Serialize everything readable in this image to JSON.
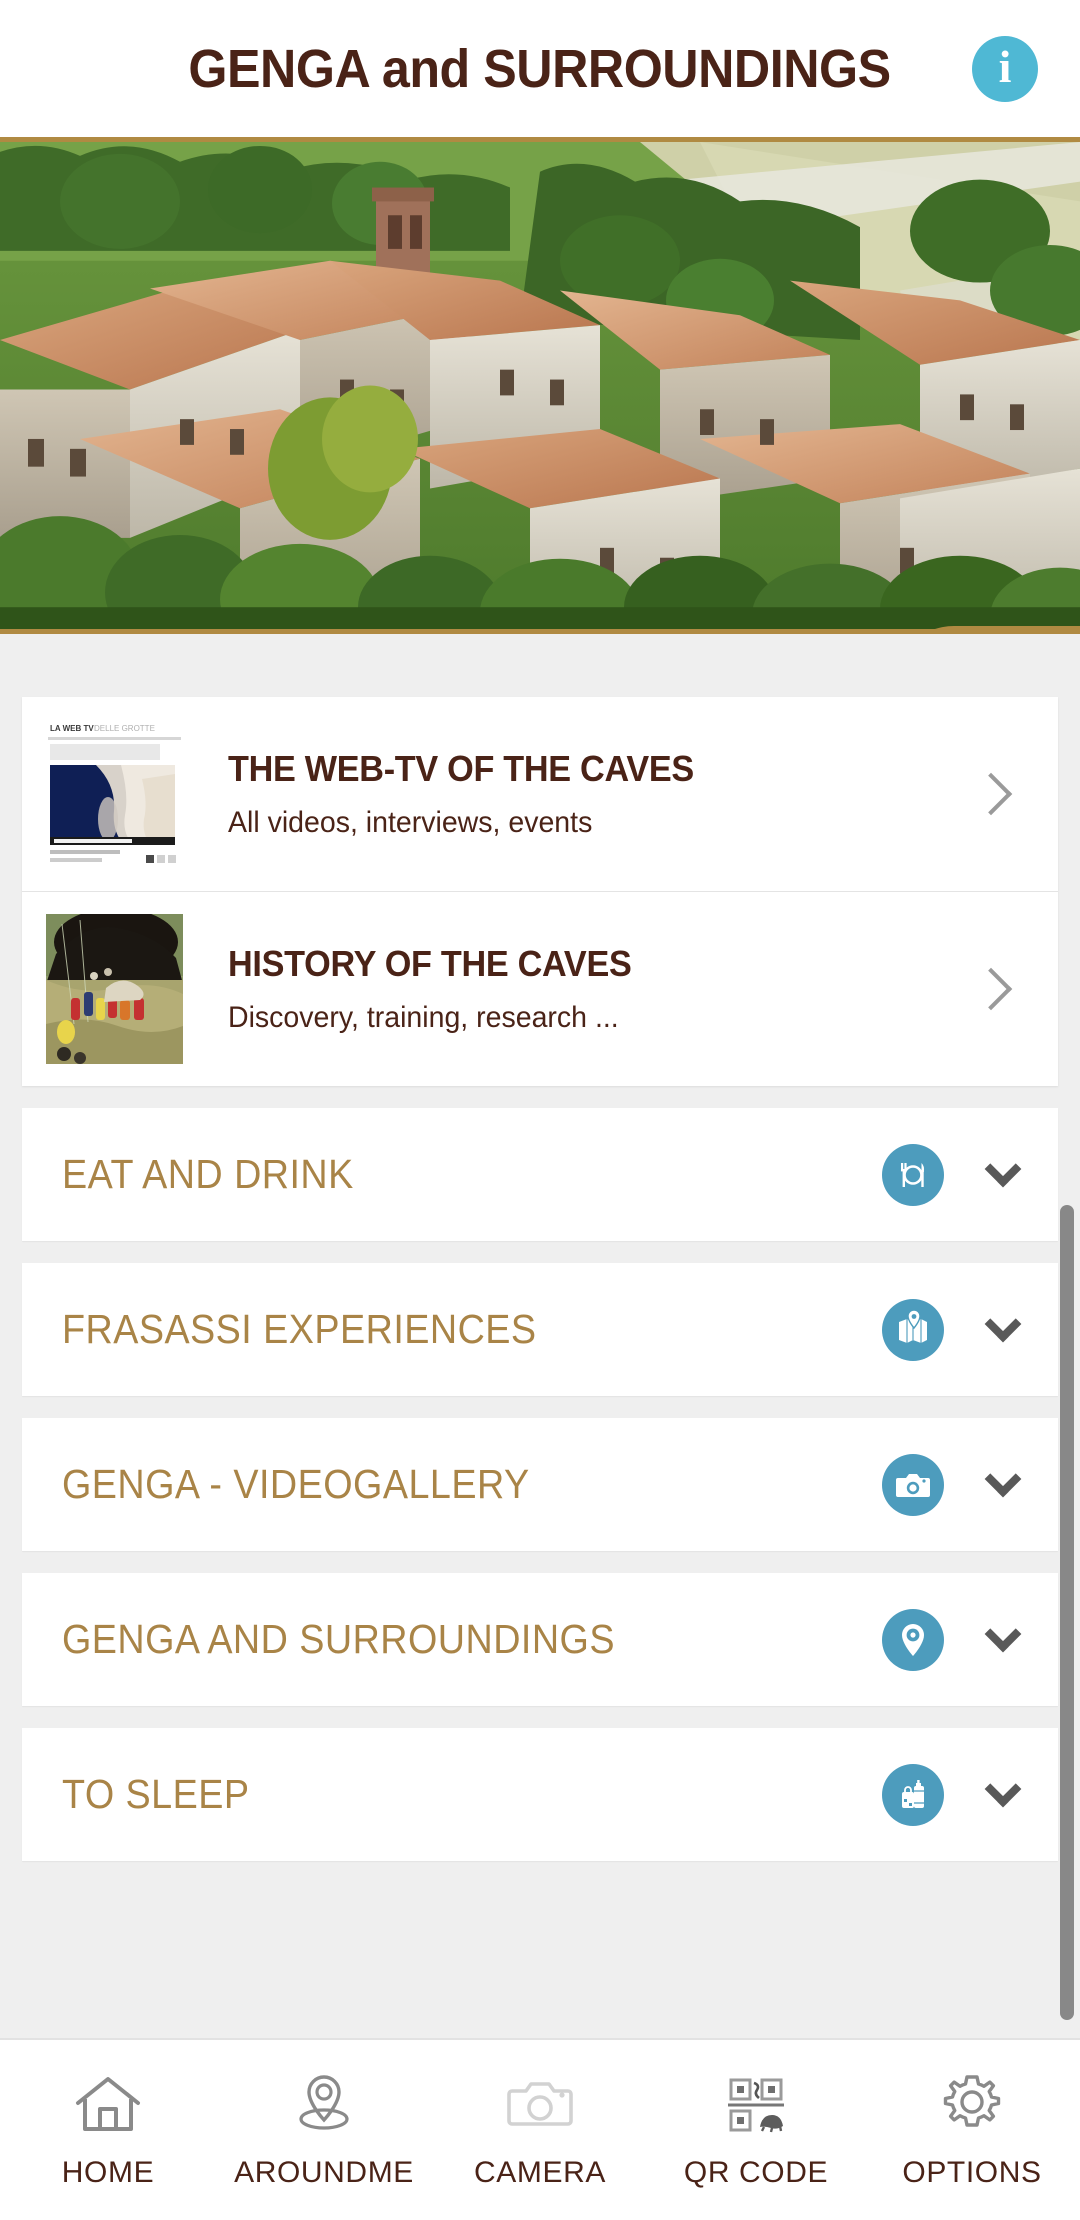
{
  "header": {
    "title": "GENGA and SURROUNDINGS",
    "info_icon": "info-icon",
    "info_glyph": "i",
    "accent_gold": "#b08a42",
    "title_color": "#4a2317",
    "info_bg": "#4fb8d4"
  },
  "hero": {
    "name": "genga-aerial-view",
    "alt": "Aerial view of Genga hill town with terracotta roofs",
    "collapse_icon": "chevron-up-icon",
    "collapse_bg": "#b08a42"
  },
  "features": [
    {
      "title": "THE WEB-TV OF THE CAVES",
      "subtitle": "All videos, interviews, events",
      "thumb": "webtv-screenshot-thumbnail",
      "thumb_caption": "LA WEB TV DELLE GROTTE",
      "chevron": "chevron-right-icon"
    },
    {
      "title": "HISTORY OF THE CAVES",
      "subtitle": "Discovery, training, research ...",
      "thumb": "cave-entrance-speleologists-thumbnail",
      "chevron": "chevron-right-icon"
    }
  ],
  "accordion": {
    "label_color": "#a98447",
    "icon_bg": "#4d9cbd",
    "items": [
      {
        "label": "EAT AND DRINK",
        "icon": "cutlery-icon",
        "chevron": "chevron-down-icon"
      },
      {
        "label": "FRASASSI EXPERIENCES",
        "icon": "map-pin-icon",
        "chevron": "chevron-down-icon"
      },
      {
        "label": "GENGA - VIDEOGALLERY",
        "icon": "camera-icon",
        "chevron": "chevron-down-icon"
      },
      {
        "label": "GENGA AND SURROUNDINGS",
        "icon": "location-pin-icon",
        "chevron": "chevron-down-icon"
      },
      {
        "label": "TO SLEEP",
        "icon": "luggage-icon",
        "chevron": "chevron-down-icon"
      }
    ]
  },
  "scrollbar": {
    "name": "vertical-scrollbar",
    "color": "#888888"
  },
  "bottomnav": {
    "label_color": "#4a2317",
    "items": [
      {
        "label": "HOME",
        "icon": "home-icon"
      },
      {
        "label": "AROUNDME",
        "icon": "location-pin-icon"
      },
      {
        "label": "CAMERA",
        "icon": "camera-icon"
      },
      {
        "label": "QR CODE",
        "icon": "qr-code-icon"
      },
      {
        "label": "OPTIONS",
        "icon": "gear-icon"
      }
    ]
  }
}
